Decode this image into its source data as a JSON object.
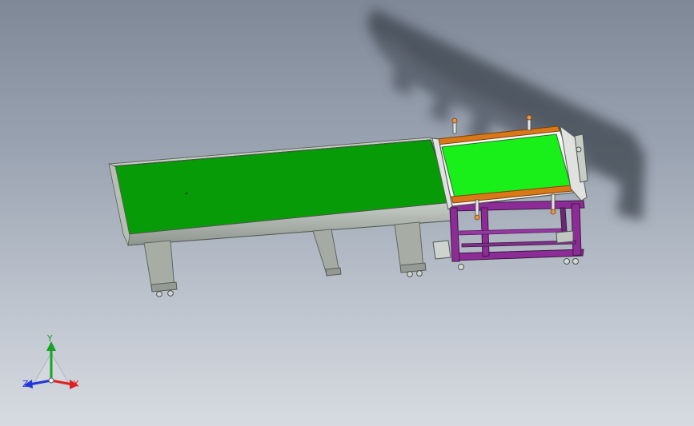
{
  "graphics_area": {
    "background": [
      "#7f8897",
      "#d7dbe1"
    ],
    "model": {
      "main_belt_color": "#079b07",
      "secondary_belt_color": "#19ef19",
      "frame_color": "#a4aca3",
      "lift_frame_color": "#8e2c97",
      "guide_rail_color": "#d97816"
    }
  },
  "triad": {
    "x_label": "X",
    "y_label": "Y",
    "z_label": "Z",
    "x_color": "#e02020",
    "y_color": "#18a324",
    "z_color": "#2036d8"
  }
}
